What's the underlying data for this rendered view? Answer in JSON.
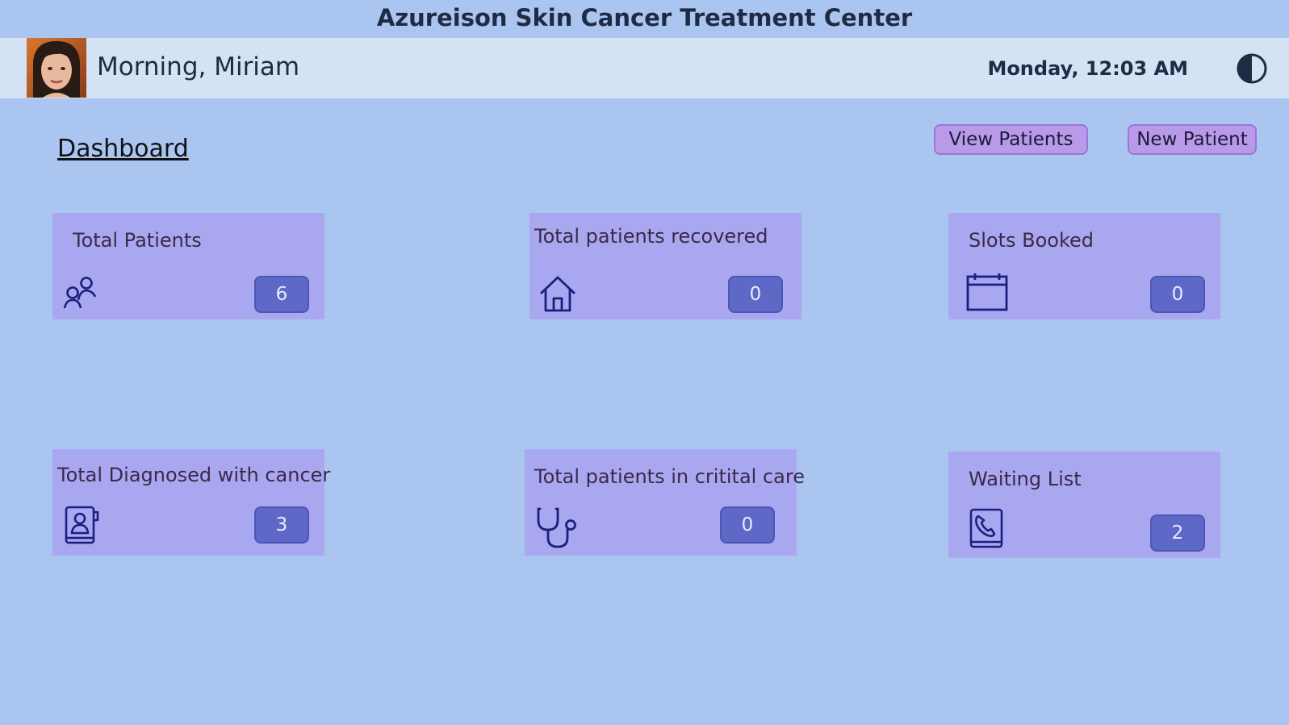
{
  "app": {
    "title": "Azureison Skin Cancer Treatment Center"
  },
  "header": {
    "greeting": "Morning, Miriam",
    "datetime": "Monday, 12:03 AM",
    "theme_icon": "contrast-icon"
  },
  "main": {
    "page_link": "Dashboard",
    "view_patients_label": "View Patients",
    "new_patient_label": "New Patient"
  },
  "cards": [
    {
      "title": "Total Patients",
      "count": "6",
      "icon": "people-icon"
    },
    {
      "title": "Total patients recovered",
      "count": "0",
      "icon": "home-icon"
    },
    {
      "title": "Slots Booked",
      "count": "0",
      "icon": "calendar-icon"
    },
    {
      "title": "Total Diagnosed with cancer",
      "count": "3",
      "icon": "contact-book-icon"
    },
    {
      "title": "Total patients in critital care",
      "count": "0",
      "icon": "stethoscope-icon"
    },
    {
      "title": "Waiting List",
      "count": "2",
      "icon": "phone-book-icon"
    }
  ],
  "colors": {
    "background": "#abc5f1",
    "header_band": "#d3e3f4",
    "card": "#a9a7ef",
    "count_badge": "#5e68c7",
    "button": "#b99ae9",
    "icon": "#1a2080"
  }
}
